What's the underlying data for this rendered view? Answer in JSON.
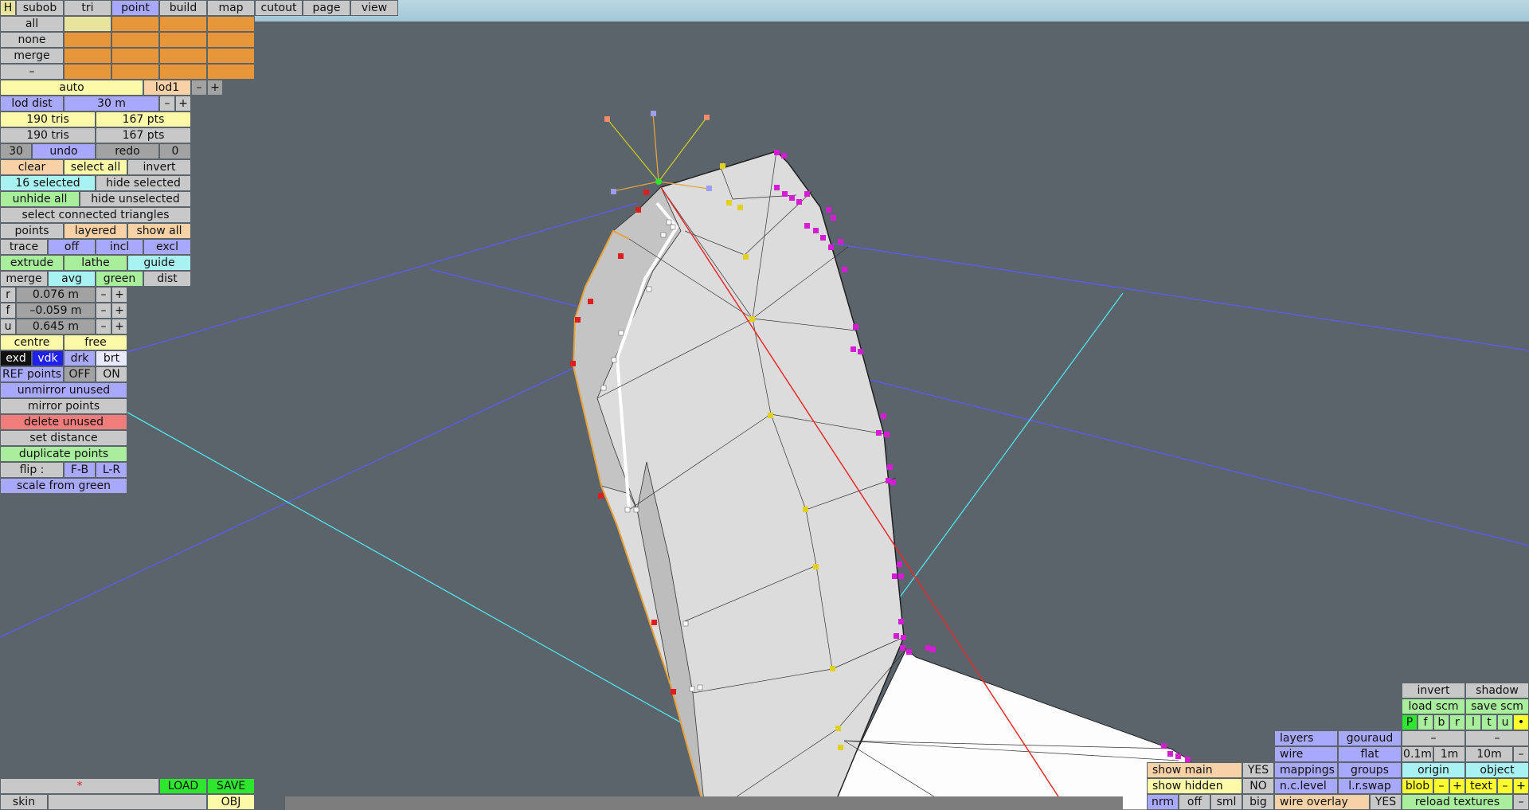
{
  "tabs": [
    "H",
    "subob",
    "tri",
    "point",
    "build",
    "map",
    "cutout",
    "page",
    "view"
  ],
  "layer_rows": [
    "all",
    "none",
    "merge",
    "–"
  ],
  "auto": "auto",
  "lod": {
    "name": "lod1",
    "minus": "–",
    "plus": "+",
    "dist_label": "lod dist",
    "dist_value": "30 m"
  },
  "stats": {
    "tris1": "190 tris",
    "pts1": "167 pts",
    "tris2": "190 tris",
    "pts2": "167 pts"
  },
  "history": {
    "count": "30",
    "undo": "undo",
    "redo": "redo",
    "redo_count": "0"
  },
  "selection": {
    "clear": "clear",
    "select_all": "select all",
    "invert": "invert",
    "count": "16 selected",
    "hide_selected": "hide selected",
    "unhide_all": "unhide all",
    "hide_unselected": "hide unselected",
    "connected": "select connected triangles"
  },
  "display": {
    "points": "points",
    "layered": "layered",
    "show_all": "show all"
  },
  "trace": {
    "label": "trace",
    "off": "off",
    "incl": "incl",
    "excl": "excl"
  },
  "ops": {
    "extrude": "extrude",
    "lathe": "lathe",
    "guide": "guide",
    "merge": "merge",
    "avg": "avg",
    "green": "green",
    "dist": "dist"
  },
  "coords": {
    "r_label": "r",
    "r_value": "0.076 m",
    "f_label": "f",
    "f_value": "–0.059 m",
    "u_label": "u",
    "u_value": "0.645 m",
    "minus": "–",
    "plus": "+"
  },
  "pivot": {
    "centre": "centre",
    "free": "free"
  },
  "shade": {
    "exd": "exd",
    "vdk": "vdk",
    "drk": "drk",
    "brt": "brt"
  },
  "ref": {
    "label": "REF points",
    "off": "OFF",
    "on": "ON"
  },
  "actions": {
    "unmirror": "unmirror unused",
    "mirror": "mirror points",
    "delete": "delete unused",
    "set_distance": "set distance",
    "duplicate": "duplicate points",
    "flip": "flip :",
    "fb": "F-B",
    "lr": "L-R",
    "scale": "scale from green"
  },
  "file": {
    "star": "*",
    "load": "LOAD",
    "save": "SAVE",
    "skin": "skin",
    "obj": "OBJ"
  },
  "right": {
    "invert": "invert",
    "shadow": "shadow",
    "load_scm": "load scm",
    "save_scm": "save scm",
    "views": [
      "P",
      "f",
      "b",
      "r",
      "l",
      "t",
      "u",
      "•"
    ],
    "layers": "layers",
    "gouraud": "gouraud",
    "dash": "–",
    "wire": "wire",
    "flat": "flat",
    "s01": "0.1m",
    "s1": "1m",
    "s10": "10m",
    "show_main": "show main",
    "yes": "YES",
    "mappings": "mappings",
    "groups": "groups",
    "origin": "origin",
    "object": "object",
    "show_hidden": "show hidden",
    "no": "NO",
    "nclevel": "n.c.level",
    "lrswap": "l.r.swap",
    "blob": "blob",
    "minus": "–",
    "plus": "+",
    "text": "text",
    "nrm": "nrm",
    "off": "off",
    "sml": "sml",
    "big": "big",
    "wire_overlay": "wire overlay",
    "reload": "reload textures"
  },
  "colors": {
    "viewport": "#5b636b",
    "selected_tab": "#a8a8ff",
    "orange": "#e8963a"
  }
}
